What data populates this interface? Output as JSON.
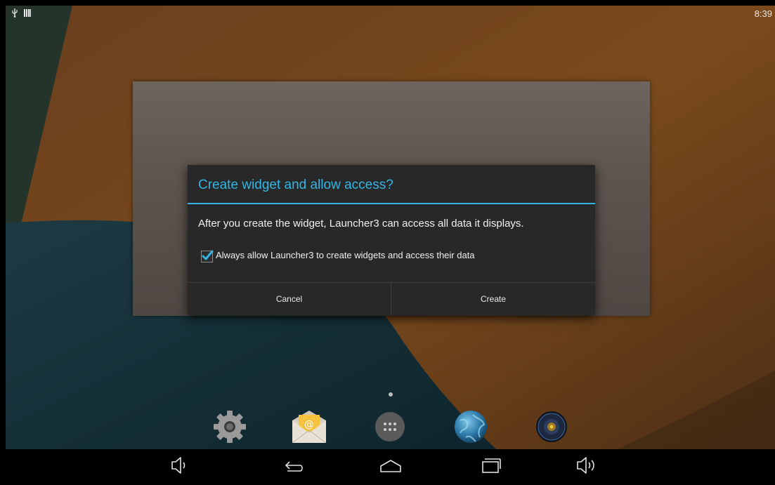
{
  "status_bar": {
    "time": "8:39",
    "icons": [
      "usb-icon",
      "signal-bars-icon"
    ]
  },
  "dialog": {
    "title": "Create widget and allow access?",
    "message": "After you create the widget, Launcher3 can access all data it displays.",
    "checkbox_label": "Always allow Launcher3 to create widgets and access their data",
    "checkbox_checked": true,
    "cancel_label": "Cancel",
    "create_label": "Create"
  },
  "dock": {
    "icons": [
      "settings-icon",
      "email-icon",
      "all-apps-icon",
      "browser-icon",
      "music-icon"
    ]
  },
  "nav_bar": {
    "icons": [
      "volume-down-icon",
      "back-icon",
      "home-icon",
      "recents-icon",
      "volume-up-icon"
    ]
  },
  "colors": {
    "accent": "#33b5e5",
    "dialog_bg": "#282828",
    "wallpaper_orange": "#7a4a1c",
    "wallpaper_teal": "#12303a"
  }
}
